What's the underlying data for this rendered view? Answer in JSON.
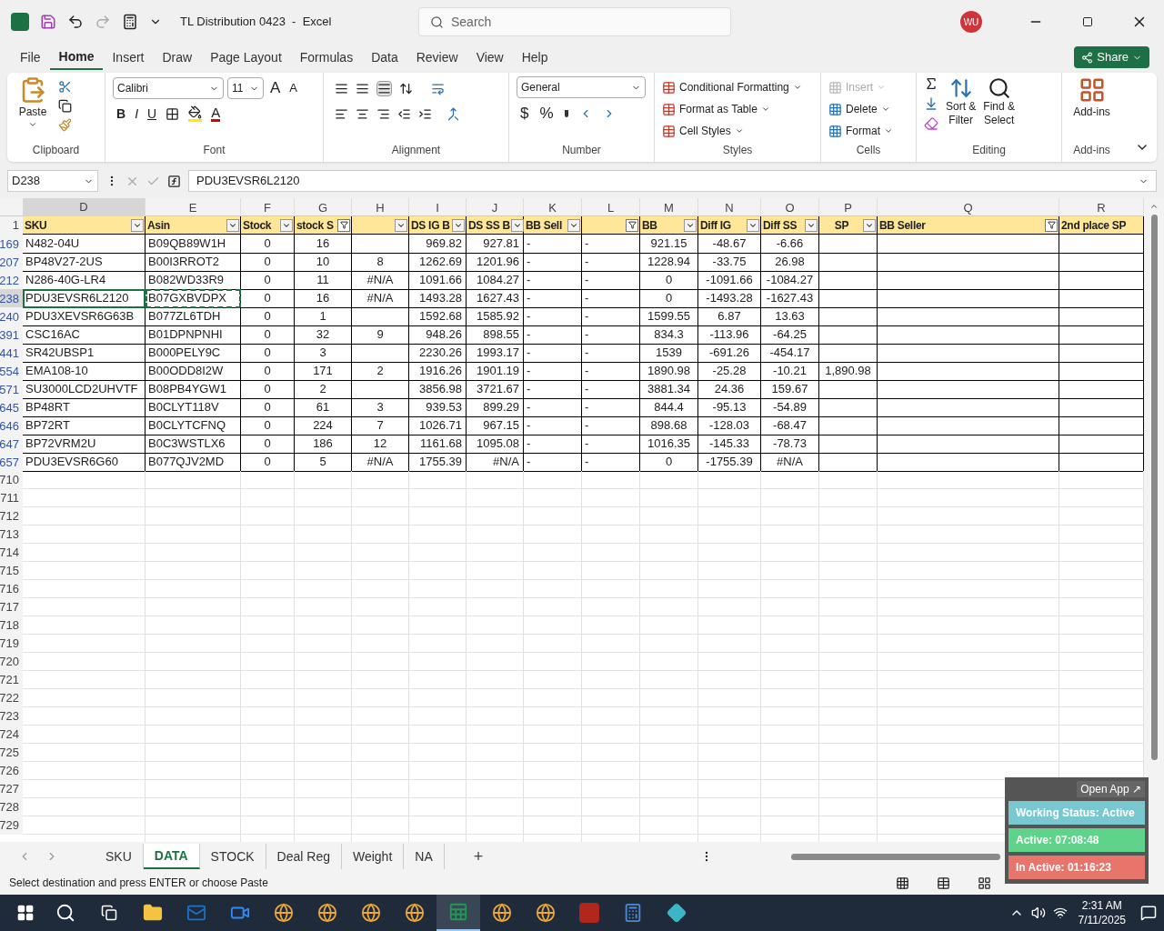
{
  "title_bar": {
    "title": "TL Distribution 0423  -  Excel",
    "search_placeholder": "Search",
    "user_initials": "WU"
  },
  "menu_tabs": [
    {
      "label": "File",
      "selected": false
    },
    {
      "label": "Home",
      "selected": true
    },
    {
      "label": "Insert",
      "selected": false
    },
    {
      "label": "Draw",
      "selected": false
    },
    {
      "label": "Page Layout",
      "selected": false
    },
    {
      "label": "Formulas",
      "selected": false
    },
    {
      "label": "Data",
      "selected": false
    },
    {
      "label": "Review",
      "selected": false
    },
    {
      "label": "View",
      "selected": false
    },
    {
      "label": "Help",
      "selected": false
    }
  ],
  "share_button": "Share",
  "ribbon": {
    "clipboard": {
      "paste": "Paste",
      "label": "Clipboard"
    },
    "font": {
      "name": "Calibri",
      "size": "11",
      "size_buttons": [
        "A",
        "A"
      ],
      "style_buttons": [
        "B",
        "I",
        "U"
      ],
      "color_letter": "A",
      "label": "Font"
    },
    "alignment": {
      "label": "Alignment"
    },
    "number": {
      "format": "General",
      "symbols": [
        "$",
        "%"
      ],
      "label": "Number"
    },
    "styles": {
      "items": [
        "Conditional Formatting",
        "Format as Table",
        "Cell Styles"
      ],
      "label": "Styles"
    },
    "cells": {
      "items": [
        {
          "label": "Insert",
          "disabled": true
        },
        {
          "label": "Delete",
          "disabled": false
        },
        {
          "label": "Format",
          "disabled": false
        }
      ],
      "label": "Cells"
    },
    "editing": {
      "sort": [
        "Sort &",
        "Filter"
      ],
      "find": [
        "Find &",
        "Select"
      ],
      "label": "Editing"
    },
    "addins": {
      "button": "Add-ins",
      "label": "Add-ins"
    }
  },
  "formula_bar": {
    "name_box": "D238",
    "formula": "PDU3EVSR6L2120"
  },
  "column_letters": [
    "D",
    "E",
    "F",
    "G",
    "H",
    "I",
    "J",
    "K",
    "L",
    "M",
    "N",
    "O",
    "P",
    "Q",
    "R"
  ],
  "header_row": {
    "number": "1",
    "cells": [
      {
        "label": "SKU",
        "filter_button": true,
        "filtered": false
      },
      {
        "label": "Asin",
        "filter_button": true,
        "filtered": false
      },
      {
        "label": "Stock",
        "filter_button": true,
        "filtered": false
      },
      {
        "label": "stock S",
        "filter_button": true,
        "filtered": true
      },
      {
        "filter_button": true,
        "filtered": false
      },
      {
        "label": "DS IG B",
        "filter_button": true,
        "filtered": false
      },
      {
        "label": "DS SS B",
        "filter_button": true,
        "filtered": false
      },
      {
        "label": "BB Sell",
        "filter_button": true,
        "filtered": false
      },
      {
        "filter_button": true,
        "filtered": true
      },
      {
        "label": "BB",
        "filter_button": true,
        "filtered": false
      },
      {
        "label": "Diff IG",
        "filter_button": true,
        "filtered": false
      },
      {
        "label": "Diff SS",
        "filter_button": true,
        "filtered": false
      },
      {
        "label": "SP",
        "filter_button": true,
        "filtered": false
      },
      {
        "label": "BB Seller",
        "filter_button": true,
        "filtered": true
      },
      {
        "label": "2nd place SP",
        "filter_button": false
      }
    ]
  },
  "rows": [
    {
      "number": "169",
      "selected": false,
      "cells": [
        "N482-04U",
        "B09QB89W1H",
        "0",
        "16",
        null,
        "969.82",
        "927.81",
        "-",
        "-",
        "921.15",
        "-48.67",
        "-6.66",
        null,
        null,
        null
      ]
    },
    {
      "number": "207",
      "selected": false,
      "cells": [
        "BP48V27-2US",
        "B00I3RROT2",
        "0",
        "10",
        "8",
        "1262.69",
        "1201.96",
        "-",
        "-",
        "1228.94",
        "-33.75",
        "26.98",
        null,
        null,
        null
      ]
    },
    {
      "number": "212",
      "selected": false,
      "cells": [
        "N286-40G-LR4",
        "B082WD33R9",
        "0",
        "11",
        "#N/A",
        "1091.66",
        "1084.27",
        "-",
        "-",
        "0",
        "-1091.66",
        "-1084.27",
        null,
        null,
        null
      ]
    },
    {
      "number": "238",
      "selected": true,
      "cells": [
        "PDU3EVSR6L2120",
        "B07GXBVDPX",
        "0",
        "16",
        "#N/A",
        "1493.28",
        "1627.43",
        "-",
        "-",
        "0",
        "-1493.28",
        "-1627.43",
        null,
        null,
        null
      ]
    },
    {
      "number": "240",
      "selected": false,
      "cells": [
        "PDU3XEVSR6G63B",
        "B077ZL6TDH",
        "0",
        "1",
        null,
        "1592.68",
        "1585.92",
        "-",
        "-",
        "1599.55",
        "6.87",
        "13.63",
        null,
        null,
        null
      ]
    },
    {
      "number": "391",
      "selected": false,
      "cells": [
        "CSC16AC",
        "B01DPNPNHI",
        "0",
        "32",
        "9",
        "948.26",
        "898.55",
        "-",
        "-",
        "834.3",
        "-113.96",
        "-64.25",
        null,
        null,
        null
      ]
    },
    {
      "number": "441",
      "selected": false,
      "cells": [
        "SR42UBSP1",
        "B000PELY9C",
        "0",
        "3",
        null,
        "2230.26",
        "1993.17",
        "-",
        "-",
        "1539",
        "-691.26",
        "-454.17",
        null,
        null,
        null
      ]
    },
    {
      "number": "554",
      "selected": false,
      "cells": [
        "EMA108-10",
        "B00ODD8I2W",
        "0",
        "171",
        "2",
        "1916.26",
        "1901.19",
        "-",
        "-",
        "1890.98",
        "-25.28",
        "-10.21",
        "1,890.98",
        null,
        null
      ]
    },
    {
      "number": "571",
      "selected": false,
      "cells": [
        "SU3000LCD2UHVTF",
        "B08PB4YGW1",
        "0",
        "2",
        null,
        "3856.98",
        "3721.67",
        "-",
        "-",
        "3881.34",
        "24.36",
        "159.67",
        null,
        null,
        null
      ]
    },
    {
      "number": "645",
      "selected": false,
      "cells": [
        "BP48RT",
        "B0CLYT118V",
        "0",
        "61",
        "3",
        "939.53",
        "899.29",
        "-",
        "-",
        "844.4",
        "-95.13",
        "-54.89",
        null,
        null,
        null
      ]
    },
    {
      "number": "646",
      "selected": false,
      "cells": [
        "BP72RT",
        "B0CLYTCFNQ",
        "0",
        "224",
        "7",
        "1026.71",
        "967.15",
        "-",
        "-",
        "898.68",
        "-128.03",
        "-68.47",
        null,
        null,
        null
      ]
    },
    {
      "number": "647",
      "selected": false,
      "cells": [
        "BP72VRM2U",
        "B0C3WSTLX6",
        "0",
        "186",
        "12",
        "1161.68",
        "1095.08",
        "-",
        "-",
        "1016.35",
        "-145.33",
        "-78.73",
        null,
        null,
        null
      ]
    },
    {
      "number": "657",
      "selected": false,
      "cells": [
        "PDU3EVSR6G60",
        "B077QJV2MD",
        "0",
        "5",
        "#N/A",
        "1755.39",
        "#N/A",
        "-",
        "-",
        "0",
        "-1755.39",
        "#N/A",
        null,
        null,
        null
      ]
    }
  ],
  "empty_rows": [
    "710",
    "711",
    "712",
    "713",
    "714",
    "715",
    "716",
    "717",
    "718",
    "719",
    "720",
    "721",
    "722",
    "723",
    "724",
    "725",
    "726",
    "727",
    "728",
    "729"
  ],
  "sheet_tabs": [
    {
      "label": "SKU",
      "selected": false
    },
    {
      "label": "DATA",
      "selected": true
    },
    {
      "label": "STOCK",
      "selected": false
    },
    {
      "label": "Deal Reg",
      "selected": false
    },
    {
      "label": "Weight",
      "selected": false
    },
    {
      "label": "NA",
      "selected": false
    }
  ],
  "add_sheet": "+",
  "status_bar": {
    "message": "Select destination and press ENTER or choose Paste"
  },
  "tracker_widget": {
    "open_app": "Open App ↗",
    "items": [
      {
        "label": "Working Status: Active",
        "color": "#79c8d0"
      },
      {
        "label": "Active: 07:08:48",
        "color": "#5fd38a"
      },
      {
        "label": "In Active: 01:16:23",
        "color": "#e8756b"
      }
    ]
  },
  "taskbar": {
    "apps": [
      {
        "kind": "folder",
        "selected": false
      },
      {
        "kind": "mail",
        "selected": false
      },
      {
        "kind": "zoom",
        "selected": false
      },
      {
        "kind": "browser",
        "selected": false
      },
      {
        "kind": "browser",
        "selected": false
      },
      {
        "kind": "browser",
        "selected": false
      },
      {
        "kind": "browser",
        "selected": false
      },
      {
        "kind": "sheet",
        "selected": true
      },
      {
        "kind": "browser",
        "selected": false
      },
      {
        "kind": "browser",
        "selected": false
      },
      {
        "kind": "ftp",
        "selected": false
      },
      {
        "kind": "calculator",
        "selected": false
      },
      {
        "kind": "diamond",
        "selected": false
      }
    ],
    "time": "2:31 AM",
    "date": "7/11/2025"
  }
}
